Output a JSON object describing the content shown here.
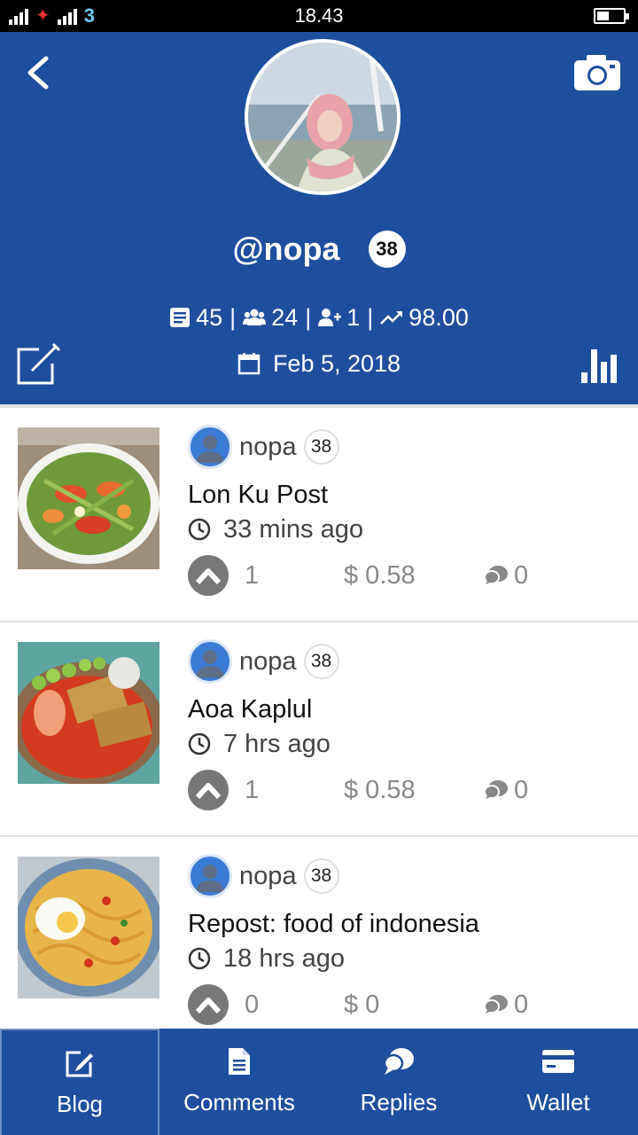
{
  "status_bar": {
    "time": "18.43",
    "carrier_3": "3",
    "battery_level": 0.45
  },
  "profile": {
    "username": "@nopa",
    "reputation": "38",
    "stats": {
      "posts": "45",
      "followers": "24",
      "following": "1",
      "power": "98.00"
    },
    "joined": "Feb 5, 2018"
  },
  "icons": {
    "back": "chevron-left-icon",
    "camera": "camera-icon",
    "edit": "edit-square-icon",
    "chart": "bar-chart-icon",
    "posts": "document-list-icon",
    "followers": "users-icon",
    "following": "user-plus-icon",
    "trend": "trending-up-icon",
    "calendar": "calendar-icon",
    "clock": "clock-icon",
    "upvote": "chevron-up-circle-icon",
    "comment": "comment-icon"
  },
  "colors": {
    "brand_blue": "#1d4f9e",
    "muted_gray": "#888888"
  },
  "posts": [
    {
      "author": "nopa",
      "reputation": "38",
      "title": "Lon Ku Post",
      "time": "33 mins ago",
      "votes": "1",
      "payout": "$ 0.58",
      "comments": "0"
    },
    {
      "author": "nopa",
      "reputation": "38",
      "title": "Aoa Kaplul",
      "time": "7 hrs ago",
      "votes": "1",
      "payout": "$ 0.58",
      "comments": "0"
    },
    {
      "author": "nopa",
      "reputation": "38",
      "title": "Repost: food of indonesia",
      "time": "18 hrs ago",
      "votes": "0",
      "payout": "$ 0",
      "comments": "0"
    }
  ],
  "tabs": [
    {
      "label": "Blog",
      "active": true
    },
    {
      "label": "Comments",
      "active": false
    },
    {
      "label": "Replies",
      "active": false
    },
    {
      "label": "Wallet",
      "active": false
    }
  ]
}
